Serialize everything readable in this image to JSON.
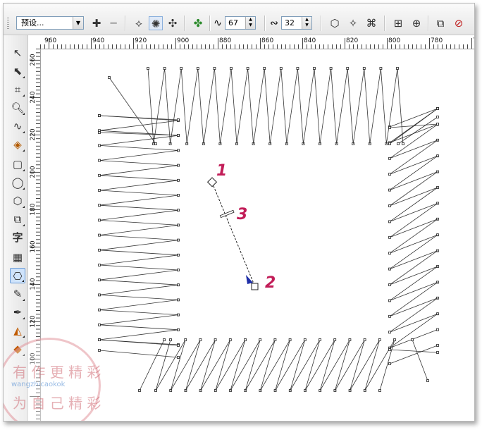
{
  "propbar": {
    "preset_value": "预设...",
    "rotation_label_value": "67",
    "offset_value": "32"
  },
  "ruler_h": [
    "960",
    "940",
    "920",
    "900",
    "880",
    "860",
    "840",
    "820",
    "800",
    "780",
    "76"
  ],
  "ruler_v": [
    "260",
    "240",
    "220",
    "200",
    "180",
    "160",
    "140",
    "120",
    "100"
  ],
  "callouts": {
    "one": "1",
    "two": "2",
    "three": "3"
  },
  "watermark": {
    "top": "有 作 更 精 彩",
    "middle": "wangzhicaokok",
    "bottom": "为 自 己 精 彩"
  },
  "icons": {
    "add": "plus-icon",
    "remove": "minus-icon",
    "toolbox": [
      "pick-tool-icon",
      "shape-tool-icon",
      "crop-tool-icon",
      "zoom-tool-icon",
      "freehand-tool-icon",
      "smart-fill-icon",
      "rectangle-tool-icon",
      "ellipse-tool-icon",
      "polygon-tool-icon",
      "basic-shapes-icon",
      "text-tool-icon",
      "table-tool-icon",
      "blend-tool-icon",
      "eyedropper-tool-icon",
      "outline-pen-icon",
      "fill-tool-icon",
      "interactive-fill-icon"
    ]
  },
  "colors": {
    "accent_callout": "#c21d58",
    "blend_arrow": "#1f2fa8"
  }
}
